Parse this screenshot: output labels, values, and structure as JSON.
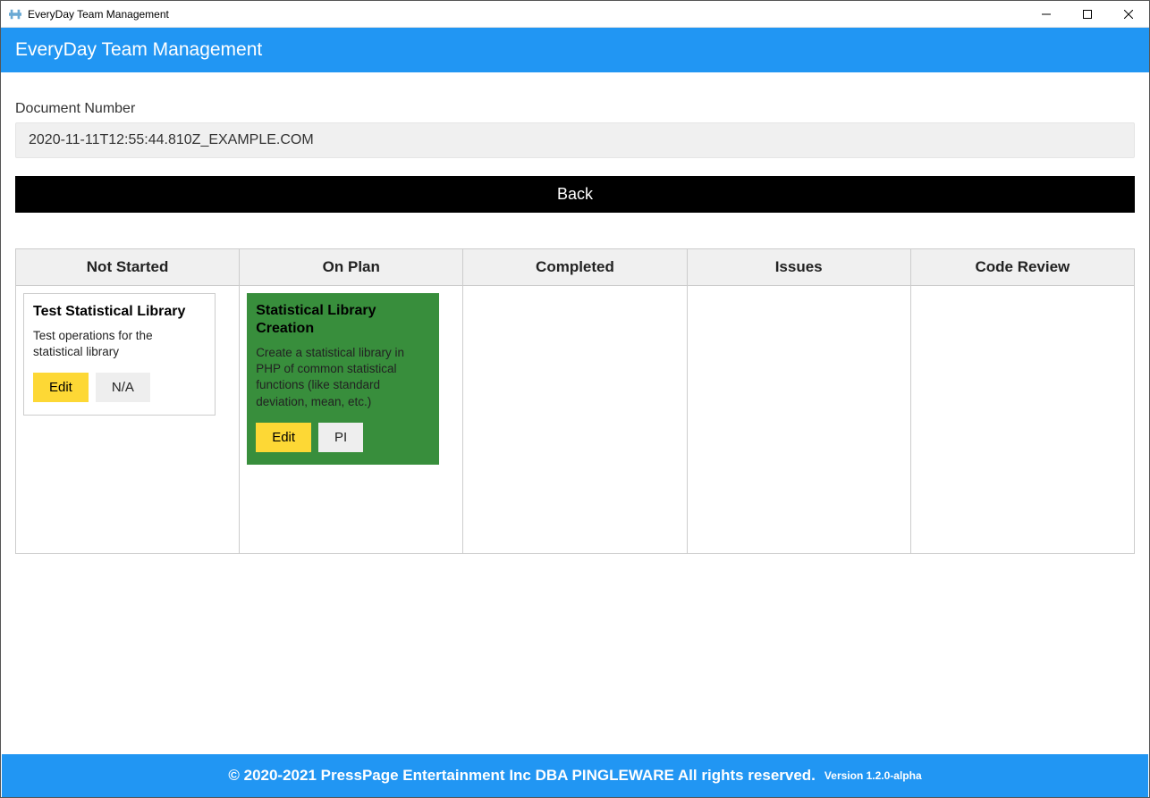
{
  "window": {
    "title": "EveryDay Team Management"
  },
  "header": {
    "title": "EveryDay Team Management"
  },
  "document": {
    "label": "Document Number",
    "value": "2020-11-11T12:55:44.810Z_EXAMPLE.COM"
  },
  "back_button": "Back",
  "board": {
    "columns": {
      "not_started": "Not Started",
      "on_plan": "On Plan",
      "completed": "Completed",
      "issues": "Issues",
      "code_review": "Code Review"
    },
    "cards": {
      "not_started": {
        "title": "Test Statistical Library",
        "desc": "Test operations for the statistical library",
        "edit": "Edit",
        "secondary": "N/A"
      },
      "on_plan": {
        "title": "Statistical Library Creation",
        "desc": "Create a statistical library in PHP of common statistical functions (like standard deviation, mean, etc.)",
        "edit": "Edit",
        "secondary": "PI"
      }
    }
  },
  "footer": {
    "copyright": "© 2020-2021 PressPage Entertainment Inc DBA PINGLEWARE  All rights reserved.",
    "version": "Version 1.2.0-alpha"
  }
}
